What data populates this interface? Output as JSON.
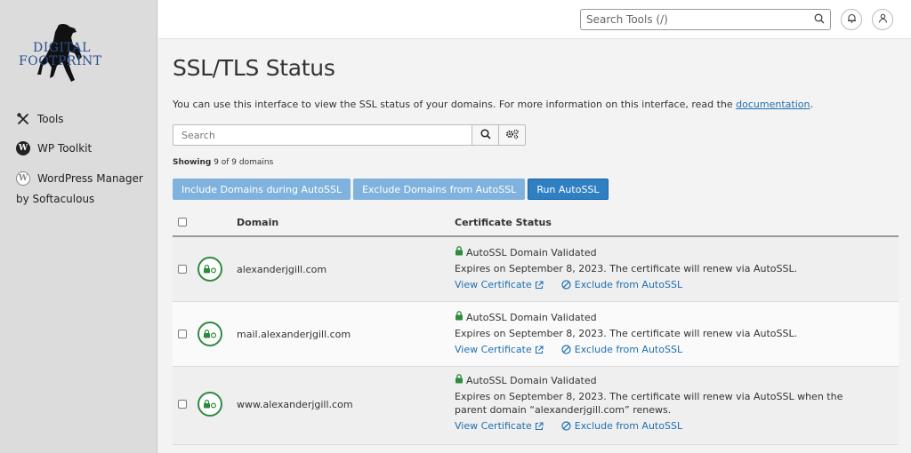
{
  "sidebar": {
    "logo": {
      "line1": "DIGITAL",
      "line2": "FOOTPRINT"
    },
    "items": [
      {
        "label": "Tools",
        "icon": "tools-icon"
      },
      {
        "label": "WP Toolkit",
        "icon": "wordpress-icon"
      },
      {
        "label": "WordPress Manager",
        "label2": "by Softaculous",
        "icon": "wordpress-icon"
      }
    ]
  },
  "header": {
    "search_placeholder": "Search Tools (/)"
  },
  "page": {
    "title": "SSL/TLS Status",
    "intro_text": "You can use this interface to view the SSL status of your domains. For more information on this interface, read the ",
    "intro_link": "documentation",
    "intro_end": ".",
    "search_placeholder": "Search",
    "showing_label": "Showing",
    "showing_rest": " 9 of 9 domains",
    "buttons": {
      "include": "Include Domains during AutoSSL",
      "exclude": "Exclude Domains from AutoSSL",
      "run": "Run AutoSSL"
    }
  },
  "table": {
    "headers": {
      "domain": "Domain",
      "status": "Certificate Status"
    },
    "rows": [
      {
        "domain": "alexanderjgill.com",
        "status": "AutoSSL Domain Validated",
        "expires": "Expires on September 8, 2023. The certificate will renew via AutoSSL.",
        "view": "View Certificate",
        "exclude": "Exclude from AutoSSL"
      },
      {
        "domain": "mail.alexanderjgill.com",
        "status": "AutoSSL Domain Validated",
        "expires": "Expires on September 8, 2023. The certificate will renew via AutoSSL.",
        "view": "View Certificate",
        "exclude": "Exclude from AutoSSL"
      },
      {
        "domain": "www.alexanderjgill.com",
        "status": "AutoSSL Domain Validated",
        "expires": "Expires on September 8, 2023. The certificate will renew via AutoSSL when the parent domain “alexanderjgill.com” renews.",
        "view": "View Certificate",
        "exclude": "Exclude from AutoSSL"
      }
    ]
  },
  "colors": {
    "sidebar_bg": "#dcdcdc",
    "accent": "#2f7fc3",
    "accent_light": "#7fb3de",
    "success": "#2e8b3e",
    "link": "#1e6fb0"
  }
}
